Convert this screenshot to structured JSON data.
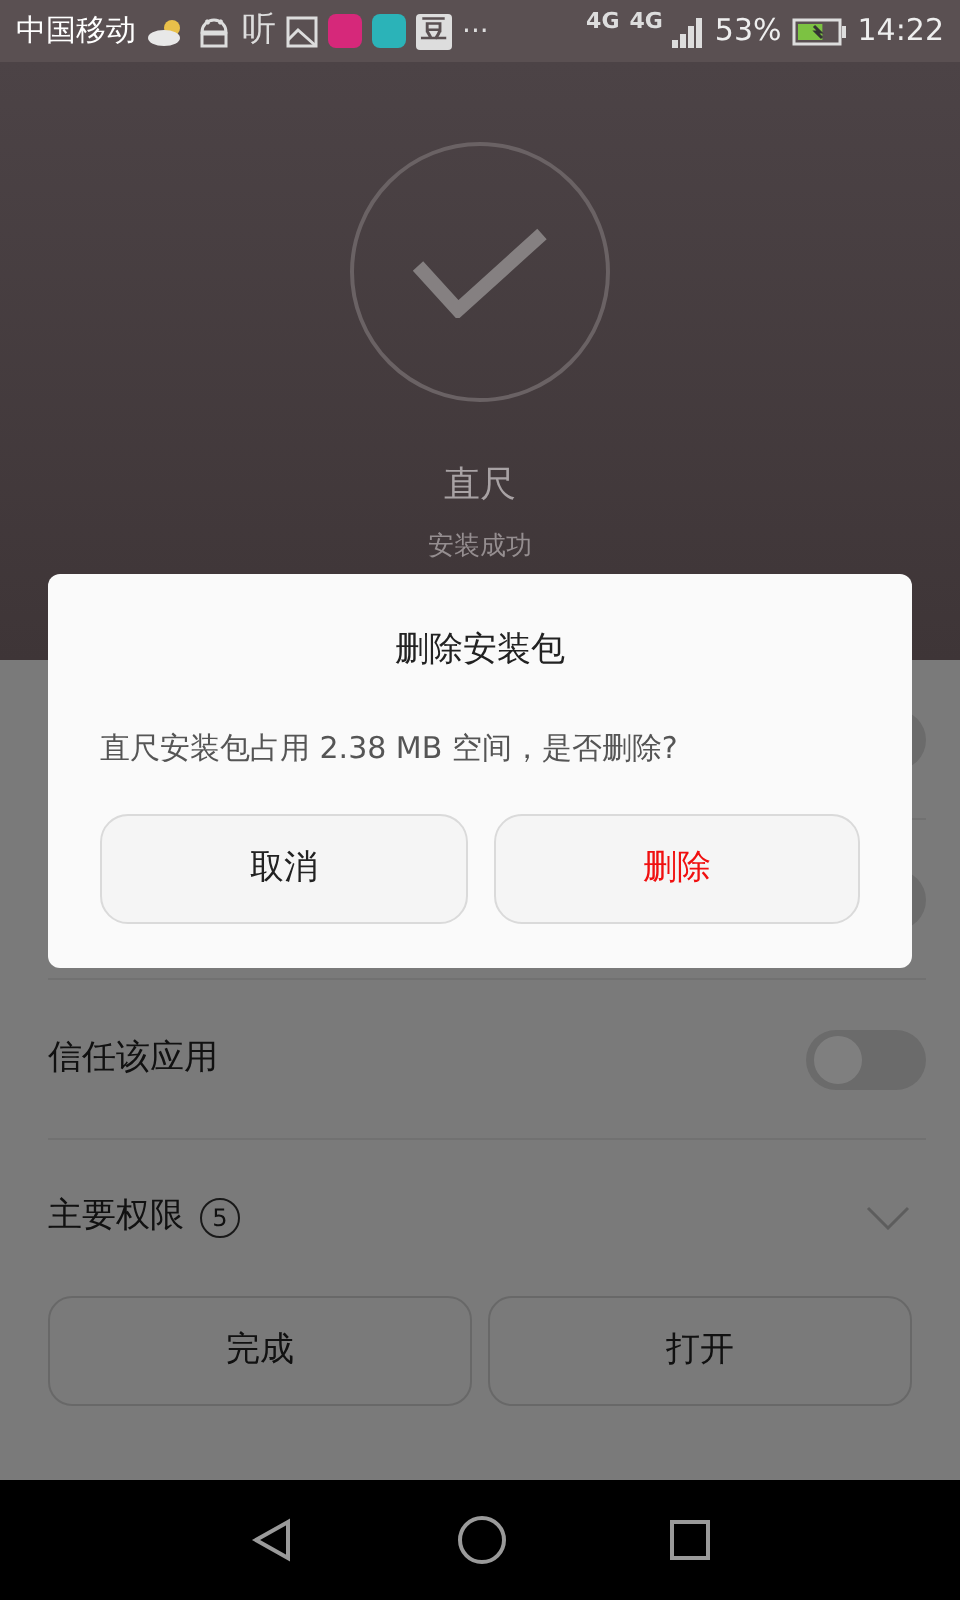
{
  "status_bar": {
    "carrier": "中国移动",
    "notifications": [
      {
        "kind": "weather"
      },
      {
        "kind": "android"
      },
      {
        "kind": "glyph",
        "text": "听"
      },
      {
        "kind": "image"
      },
      {
        "kind": "app",
        "color": "#d6287a"
      },
      {
        "kind": "app",
        "color": "#2bb3b8"
      },
      {
        "kind": "glyph_box",
        "text": "豆"
      },
      {
        "kind": "more",
        "text": "···"
      }
    ],
    "network": [
      "4G",
      "4G"
    ],
    "battery": "53%",
    "time": "14:22"
  },
  "header": {
    "app_name": "直尺",
    "status": "安装成功"
  },
  "settings_rows": [
    {
      "kind": "toggle",
      "on": false
    },
    {
      "kind": "toggle",
      "on": false
    },
    {
      "kind": "toggle",
      "label": "信任该应用",
      "on": false
    },
    {
      "kind": "expand",
      "label": "主要权限",
      "count": "5",
      "expanded": false
    }
  ],
  "footer_buttons": [
    "完成",
    "打开"
  ],
  "dialog": {
    "title": "删除安装包",
    "message": "直尺安装包占用 2.38 MB 空间，是否删除?",
    "buttons": [
      {
        "label": "取消",
        "kind": "normal"
      },
      {
        "label": "删除",
        "kind": "danger"
      }
    ]
  }
}
